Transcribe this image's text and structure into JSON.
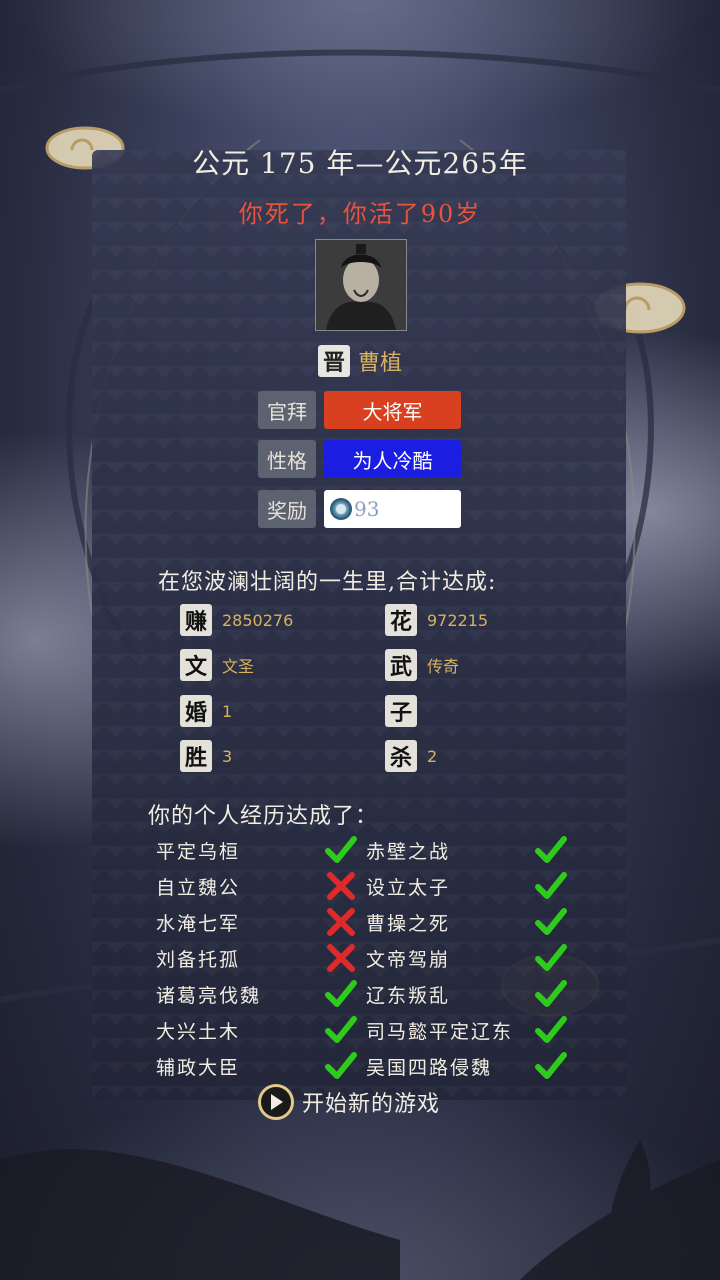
{
  "header": {
    "year_range": "公元 175 年—公元265年",
    "death_text": "你死了，你活了90岁"
  },
  "character": {
    "kingdom_badge": "晋",
    "name": "曹植",
    "portrait_icon": "character-portrait"
  },
  "info": {
    "rows": [
      {
        "label": "官拜",
        "value": "大将军",
        "color": "#d8401f"
      },
      {
        "label": "性格",
        "value": "为人冷酷",
        "color": "#1a1ee0"
      },
      {
        "label": "奖励",
        "value": "93",
        "icon": "coin-icon"
      }
    ]
  },
  "summary": {
    "heading": "在您波澜壮阔的一生里,合计达成:",
    "stats": [
      {
        "icon": "赚",
        "value": "2850276"
      },
      {
        "icon": "花",
        "value": "972215"
      },
      {
        "icon": "文",
        "value": "文圣"
      },
      {
        "icon": "武",
        "value": "传奇"
      },
      {
        "icon": "婚",
        "value": "1"
      },
      {
        "icon": "子",
        "value": ""
      },
      {
        "icon": "胜",
        "value": "3"
      },
      {
        "icon": "杀",
        "value": "2"
      }
    ]
  },
  "experiences": {
    "heading": "你的个人经历达成了：",
    "left": [
      {
        "name": "平定乌桓",
        "done": true
      },
      {
        "name": "自立魏公",
        "done": false
      },
      {
        "name": "水淹七军",
        "done": false
      },
      {
        "name": "刘备托孤",
        "done": false
      },
      {
        "name": "诸葛亮伐魏",
        "done": true
      },
      {
        "name": "大兴土木",
        "done": true
      },
      {
        "name": "辅政大臣",
        "done": true
      }
    ],
    "right": [
      {
        "name": "赤壁之战",
        "done": true
      },
      {
        "name": "设立太子",
        "done": true
      },
      {
        "name": "曹操之死",
        "done": true
      },
      {
        "name": "文帝驾崩",
        "done": true
      },
      {
        "name": "辽东叛乱",
        "done": true
      },
      {
        "name": "司马懿平定辽东",
        "done": true
      },
      {
        "name": "吴国四路侵魏",
        "done": true
      }
    ]
  },
  "actions": {
    "new_game": "开始新的游戏"
  },
  "colors": {
    "check": "#2ecc1a",
    "cross": "#e02a2a",
    "gold": "#d9b15e"
  }
}
